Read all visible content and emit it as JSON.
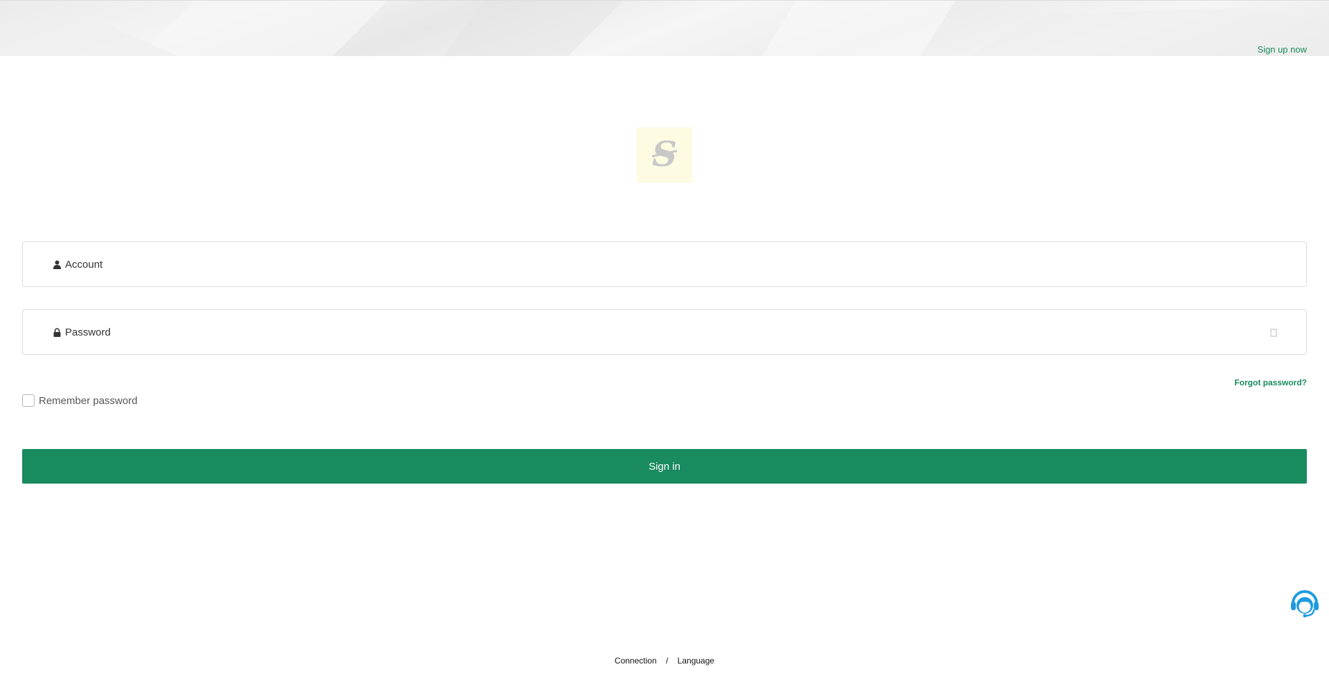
{
  "header": {
    "signup_label": "Sign up now"
  },
  "logo": {
    "icon": "s-logo-icon",
    "bg_color": "#fdfbe1"
  },
  "form": {
    "account_placeholder": "Account",
    "account_icon": "user-icon",
    "password_placeholder": "Password",
    "password_icon": "lock-icon",
    "toggle_icon": "eye-icon",
    "forgot_label": "Forgot password?",
    "remember_label": "Remember password",
    "remember_checked": false,
    "signin_label": "Sign in"
  },
  "support": {
    "icon": "customer-service-icon"
  },
  "footer": {
    "connection_label": "Connection",
    "separator": "/",
    "language_label": "Language"
  },
  "colors": {
    "accent": "#1a8b5f",
    "link": "#1a8a5e",
    "support": "#1e9be0"
  }
}
